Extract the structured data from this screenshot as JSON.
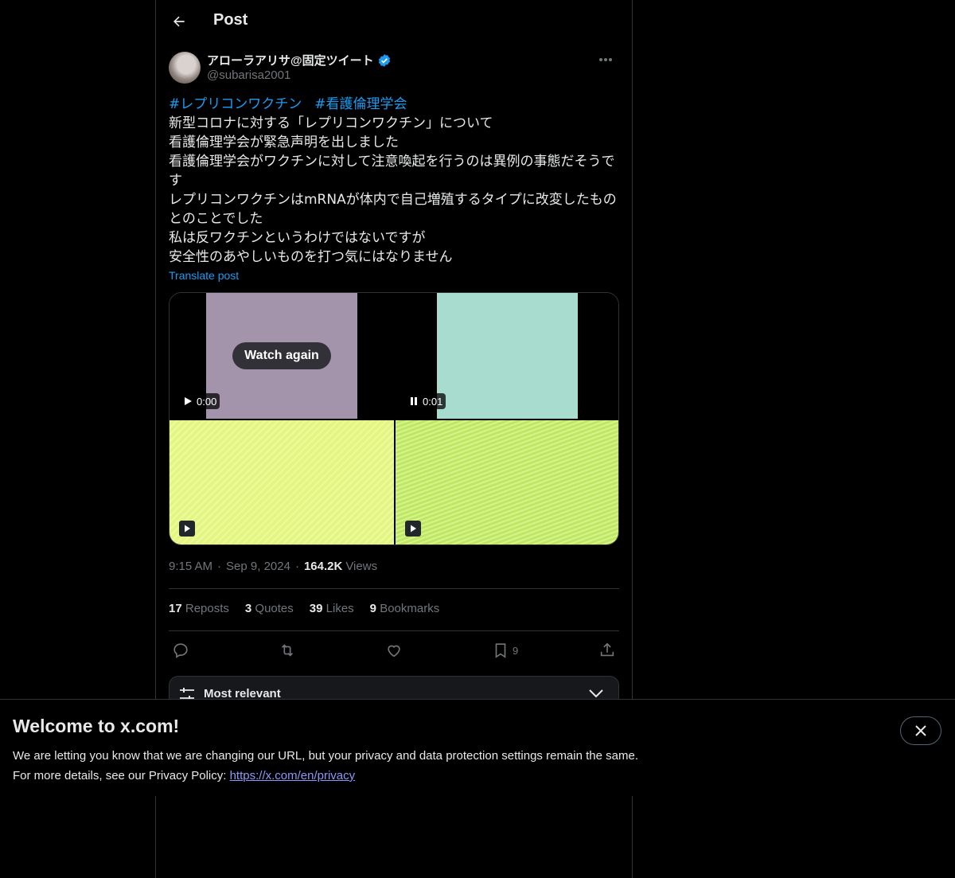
{
  "header": {
    "title": "Post"
  },
  "author": {
    "display_name": "アローラアリサ@固定ツイート",
    "handle": "@subarisa2001",
    "verified": true
  },
  "post": {
    "hashtags": [
      "#レプリコンワクチン",
      "#看護倫理学会"
    ],
    "lines": [
      "新型コロナに対する「レプリコンワクチン」について",
      "看護倫理学会が緊急声明を出しました",
      "看護倫理学会がワクチンに対して注意喚起を行うのは異例の事態だそうです",
      "レプリコンワクチンはmRNAが体内で自己増殖するタイプに改変したものとのことでした",
      "私は反ワクチンというわけではないですが",
      "安全性のあやしいものを打つ気にはなりません"
    ],
    "translate_label": "Translate post"
  },
  "media": {
    "watch_again": "Watch again",
    "video1_time": "0:00",
    "video2_time": "0:01",
    "colors": [
      "#a394ab",
      "#a7dccf",
      "#e8fa86",
      "#c9f26a"
    ]
  },
  "meta": {
    "time": "9:15 AM",
    "date": "Sep 9, 2024",
    "views_count": "164.2K",
    "views_label": "Views"
  },
  "stats": {
    "reposts_count": "17",
    "reposts_label": "Reposts",
    "quotes_count": "3",
    "quotes_label": "Quotes",
    "likes_count": "39",
    "likes_label": "Likes",
    "bookmarks_count": "9",
    "bookmarks_label": "Bookmarks"
  },
  "actions": {
    "bookmark_count": "9"
  },
  "sort": {
    "label": "Most relevant"
  },
  "banner": {
    "title": "Welcome to x.com!",
    "line1": "We are letting you know that we are changing our URL, but your privacy and data protection settings remain the same.",
    "line2_prefix": "For more details, see our Privacy Policy: ",
    "link": "https://x.com/en/privacy"
  },
  "colors": {
    "accent": "#1d9bf0",
    "muted": "#71767b",
    "text": "#e7e9ea",
    "border": "#2f3336"
  }
}
